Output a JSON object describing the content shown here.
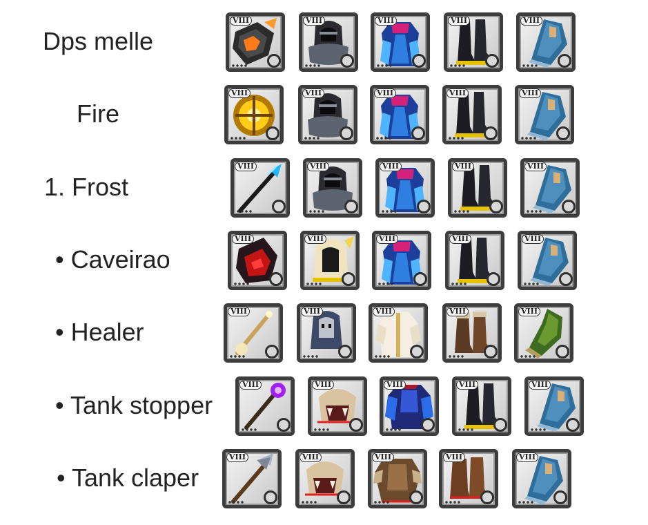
{
  "rows": [
    {
      "label": "Dps melle",
      "items": [
        {
          "name": "weapon-gauntlet-icon",
          "tier": "VIII"
        },
        {
          "name": "hood-icon",
          "tier": "VIII"
        },
        {
          "name": "robe-icon",
          "tier": "VIII"
        },
        {
          "name": "boots-icon",
          "tier": "VIII"
        },
        {
          "name": "cape-icon",
          "tier": "VIII"
        }
      ]
    },
    {
      "label": "Fire",
      "items": [
        {
          "name": "fire-orb-icon",
          "tier": "VIII"
        },
        {
          "name": "hood-icon",
          "tier": "VIII"
        },
        {
          "name": "robe-icon",
          "tier": "VIII"
        },
        {
          "name": "boots-icon",
          "tier": "VIII"
        },
        {
          "name": "cape-icon",
          "tier": "VIII"
        }
      ]
    },
    {
      "label": "1. Frost",
      "items": [
        {
          "name": "frost-staff-icon",
          "tier": "VIII"
        },
        {
          "name": "hood-icon",
          "tier": "VIII"
        },
        {
          "name": "robe-icon",
          "tier": "VIII"
        },
        {
          "name": "boots-icon",
          "tier": "VIII"
        },
        {
          "name": "cape-icon",
          "tier": "VIII"
        }
      ]
    },
    {
      "label": "• Caveirao",
      "items": [
        {
          "name": "cursed-tome-icon",
          "tier": "VIII"
        },
        {
          "name": "golden-hood-icon",
          "tier": "VIII"
        },
        {
          "name": "robe-icon",
          "tier": "VIII"
        },
        {
          "name": "boots-icon",
          "tier": "VIII"
        },
        {
          "name": "cape-icon",
          "tier": "VIII"
        }
      ]
    },
    {
      "label": "• Healer",
      "items": [
        {
          "name": "holy-staff-icon",
          "tier": "VIII"
        },
        {
          "name": "cleric-cowl-icon",
          "tier": "VIII"
        },
        {
          "name": "cleric-robe-icon",
          "tier": "VIII"
        },
        {
          "name": "leather-boots-icon",
          "tier": "VIII"
        },
        {
          "name": "green-cape-icon",
          "tier": "VIII"
        }
      ]
    },
    {
      "label": "• Tank stopper",
      "items": [
        {
          "name": "arcane-staff-icon",
          "tier": "VIII"
        },
        {
          "name": "beast-helmet-icon",
          "tier": "VIII"
        },
        {
          "name": "plate-armor-icon",
          "tier": "VIII"
        },
        {
          "name": "boots-icon",
          "tier": "VIII"
        },
        {
          "name": "cape-icon",
          "tier": "VIII"
        }
      ]
    },
    {
      "label": "•  Tank claper",
      "items": [
        {
          "name": "polearm-icon",
          "tier": "VIII"
        },
        {
          "name": "beast-helmet-icon",
          "tier": "VIII"
        },
        {
          "name": "fur-armor-icon",
          "tier": "VIII"
        },
        {
          "name": "fur-boots-icon",
          "tier": "VIII"
        },
        {
          "name": "cape-icon",
          "tier": "VIII"
        }
      ]
    }
  ]
}
